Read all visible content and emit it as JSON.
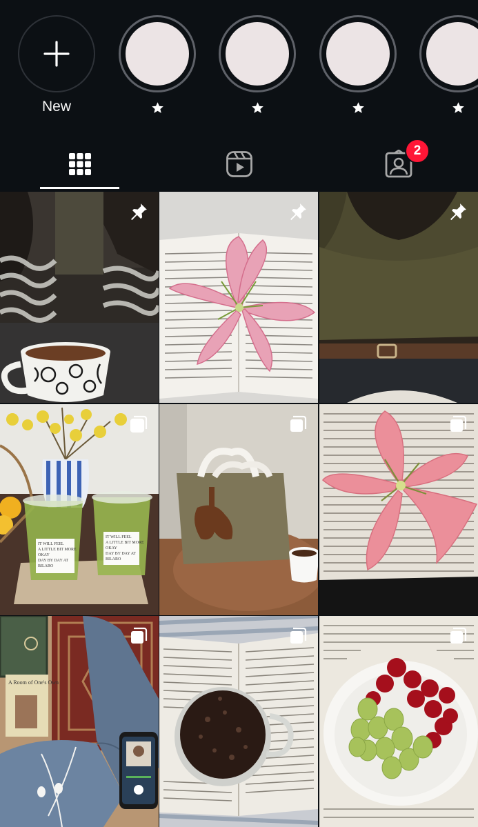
{
  "highlights": [
    {
      "label": "New",
      "type": "new"
    },
    {
      "label": "★",
      "type": "highlight"
    },
    {
      "label": "★",
      "type": "highlight"
    },
    {
      "label": "★",
      "type": "highlight"
    },
    {
      "label": "★",
      "type": "highlight"
    }
  ],
  "tabs": {
    "items": [
      {
        "name": "posts-grid",
        "icon": "grid-icon",
        "selected": true
      },
      {
        "name": "reels",
        "icon": "reels-icon",
        "selected": false
      },
      {
        "name": "tagged",
        "icon": "tagged-person-icon",
        "selected": false
      }
    ],
    "tagged_badge": "2"
  },
  "grid": {
    "posts": [
      {
        "subject": "striped sweater with floral coffee mug",
        "overlay_icon": "pin-icon"
      },
      {
        "subject": "pink lily on open book",
        "overlay_icon": "pin-icon"
      },
      {
        "subject": "olive shirt with brown belt and jeans",
        "overlay_icon": "pin-icon"
      },
      {
        "subject": "matcha drinks in cup holder with lemons",
        "overlay_icon": "carousel-icon",
        "cup_text": "IT WILL FEEL A LITTLE BIT MORE OKAY DAY BY DAY AT BILARO"
      },
      {
        "subject": "jute tote bag with coffee cup",
        "overlay_icon": "carousel-icon"
      },
      {
        "subject": "pink lily on book pages",
        "overlay_icon": "carousel-icon"
      },
      {
        "subject": "books, rug, jeans and phone",
        "overlay_icon": "carousel-icon",
        "book_title": "A Room of One's Own"
      },
      {
        "subject": "iced tea on open book",
        "overlay_icon": "carousel-icon"
      },
      {
        "subject": "bowl of grapes and cherries on book",
        "overlay_icon": "carousel-icon"
      }
    ]
  },
  "colors": {
    "background": "#0c1014",
    "accent_badge": "#ff1636",
    "ring": "#5e6168",
    "highlight_fill": "#ece4e5"
  }
}
